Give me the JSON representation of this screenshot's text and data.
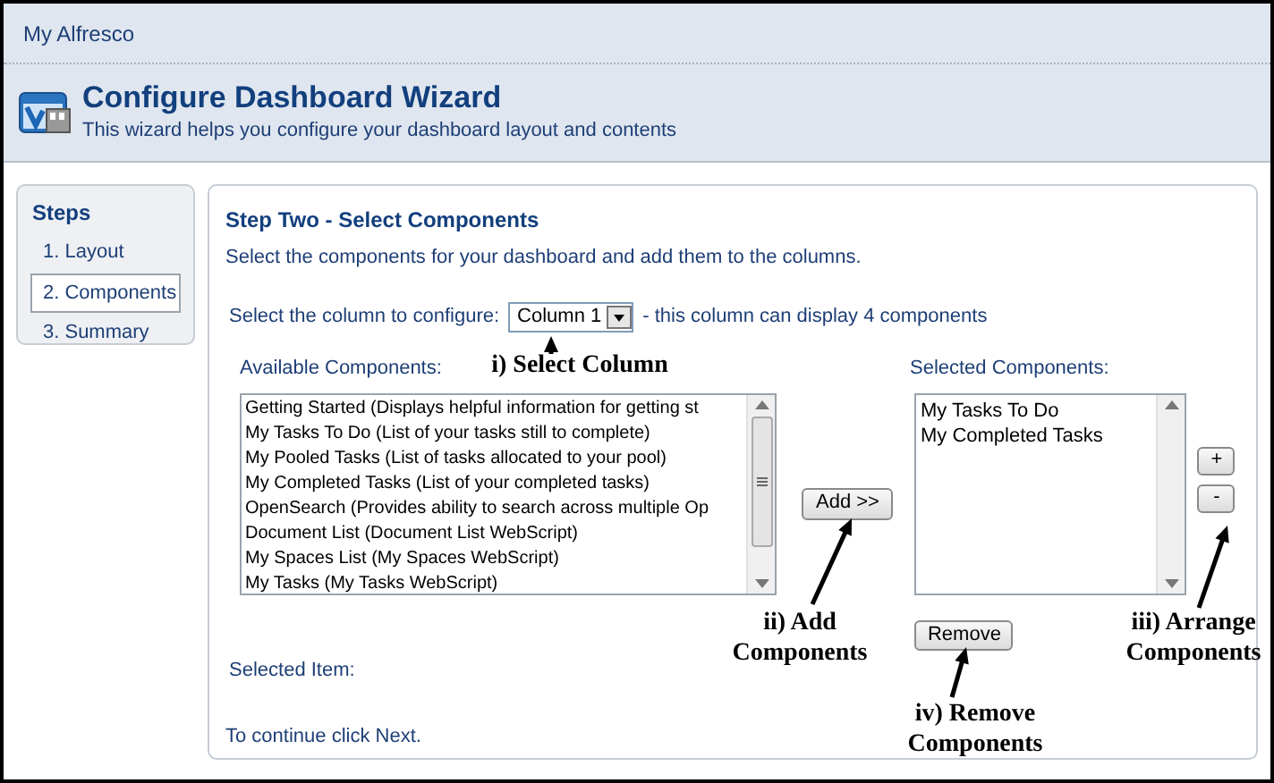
{
  "breadcrumb": "My Alfresco",
  "header": {
    "title": "Configure Dashboard Wizard",
    "subtitle": "This wizard helps you configure your dashboard layout and contents"
  },
  "steps": {
    "title": "Steps",
    "items": [
      {
        "label": "1. Layout",
        "selected": false
      },
      {
        "label": "2. Components",
        "selected": true
      },
      {
        "label": "3. Summary",
        "selected": false
      }
    ]
  },
  "main": {
    "title": "Step Two - Select Components",
    "description": "Select the components for your dashboard and add them to the columns.",
    "column_label": "Select the column to configure:",
    "column_value": "Column 1",
    "column_note": "- this column can display 4 components",
    "available_label": "Available Components:",
    "available": [
      "Getting Started (Displays helpful information for getting st",
      "My Tasks To Do (List of your tasks still to complete)",
      "My Pooled Tasks (List of tasks allocated to your pool)",
      "My Completed Tasks (List of your completed tasks)",
      "OpenSearch (Provides ability to search across multiple Op",
      "Document List (Document List WebScript)",
      "My Spaces List (My Spaces WebScript)",
      "My Tasks (My Tasks WebScript)"
    ],
    "add_button": "Add >>",
    "selected_label": "Selected Components:",
    "selected": [
      "My Tasks To Do",
      "My Completed Tasks"
    ],
    "up_button": "+",
    "down_button": "-",
    "remove_button": "Remove",
    "selected_item_label": "Selected Item:",
    "footer": "To continue click Next."
  },
  "annotations": [
    {
      "text": "i) Select Column"
    },
    {
      "text": "ii) Add Components"
    },
    {
      "text": "iii) Arrange Components"
    },
    {
      "text": "iv) Remove Components"
    }
  ]
}
